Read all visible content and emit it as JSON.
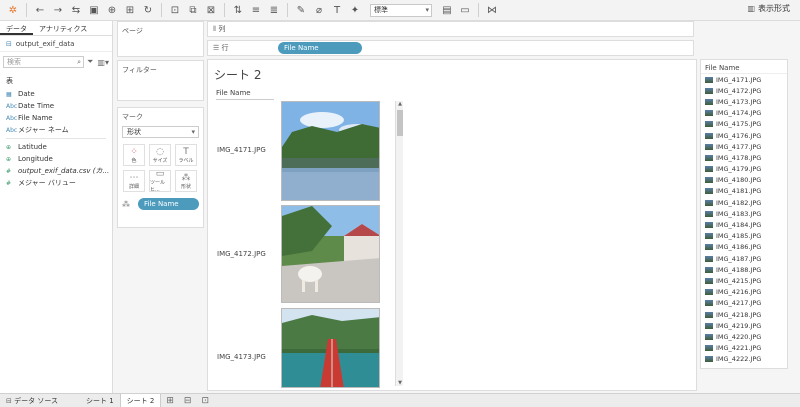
{
  "toolbar": {
    "format_select": "標準",
    "show_me": "表示形式"
  },
  "data_pane": {
    "tabs": [
      "データ",
      "アナリティクス"
    ],
    "datasource": "output_exif_data",
    "search_placeholder": "検索",
    "tables_title": "表",
    "dimensions": [
      {
        "icon": "date",
        "label": "Date"
      },
      {
        "icon": "Abc",
        "label": "Date Time"
      },
      {
        "icon": "Abc",
        "label": "File Name"
      },
      {
        "icon": "Abc",
        "label": "メジャー ネーム"
      }
    ],
    "measures": [
      {
        "icon": "globe",
        "label": "Latitude"
      },
      {
        "icon": "globe",
        "label": "Longitude"
      },
      {
        "icon": "#",
        "label": "output_exif_data.csv (カ..."
      },
      {
        "icon": "#",
        "label": "メジャー バリュー"
      }
    ]
  },
  "cards": {
    "pages": "ページ",
    "filters": "フィルター",
    "marks": "マーク",
    "marks_type": "形状",
    "mark_buttons": [
      {
        "glyph": "⁘",
        "label": "色"
      },
      {
        "glyph": "◌",
        "label": "サイズ"
      },
      {
        "glyph": "T",
        "label": "ラベル"
      },
      {
        "glyph": "⋯",
        "label": "詳細"
      },
      {
        "glyph": "▭",
        "label": "ツールヒ..."
      },
      {
        "glyph": "⁂",
        "label": "形状"
      }
    ],
    "marks_pill": "File Name"
  },
  "shelves": {
    "columns_label": "列",
    "rows_label": "行",
    "rows_pill": "File Name"
  },
  "view": {
    "sheet_title": "シート 2",
    "column_header": "File Name",
    "rows": [
      {
        "label": "IMG_4171.JPG"
      },
      {
        "label": "IMG_4172.JPG"
      },
      {
        "label": "IMG_4173.JPG"
      }
    ]
  },
  "legend": {
    "title": "File Name",
    "items": [
      "IMG_4171.JPG",
      "IMG_4172.JPG",
      "IMG_4173.JPG",
      "IMG_4174.JPG",
      "IMG_4175.JPG",
      "IMG_4176.JPG",
      "IMG_4177.JPG",
      "IMG_4178.JPG",
      "IMG_4179.JPG",
      "IMG_4180.JPG",
      "IMG_4181.JPG",
      "IMG_4182.JPG",
      "IMG_4183.JPG",
      "IMG_4184.JPG",
      "IMG_4185.JPG",
      "IMG_4186.JPG",
      "IMG_4187.JPG",
      "IMG_4188.JPG",
      "IMG_4215.JPG",
      "IMG_4216.JPG",
      "IMG_4217.JPG",
      "IMG_4218.JPG",
      "IMG_4219.JPG",
      "IMG_4220.JPG",
      "IMG_4221.JPG",
      "IMG_4222.JPG"
    ]
  },
  "bottom_tabs": {
    "datasource": "データ ソース",
    "sheet1": "シート 1",
    "sheet2": "シート 2"
  }
}
